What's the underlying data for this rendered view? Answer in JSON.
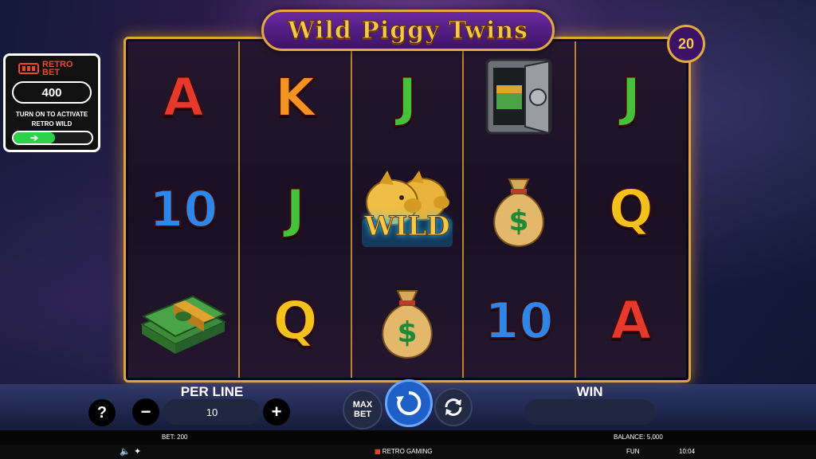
{
  "game": {
    "title": "Wild Piggy Twins",
    "lines": "20"
  },
  "retro_bet": {
    "logo_top": "RETRO",
    "logo_bottom": "BET",
    "value": "400",
    "text_line1": "TURN ON TO ACTIVATE",
    "text_line2": "RETRO WILD"
  },
  "reels": [
    [
      "A",
      "10",
      "cash-stack"
    ],
    [
      "K",
      "J",
      "Q"
    ],
    [
      "J",
      "wild-piggy",
      "money-bag"
    ],
    [
      "safe",
      "money-bag",
      "10"
    ],
    [
      "J",
      "Q",
      "A"
    ]
  ],
  "wild_label": "WILD",
  "controls": {
    "help": "?",
    "per_line_label": "PER LINE",
    "per_line_value": "10",
    "minus": "−",
    "plus": "+",
    "max_bet_line1": "MAX",
    "max_bet_line2": "BET",
    "win_label": "WIN",
    "win_value": ""
  },
  "status": {
    "bet": "BET: 200",
    "balance": "BALANCE: 5,000"
  },
  "footer": {
    "brand": "RETRO GAMING",
    "mode": "FUN",
    "time": "10:04"
  },
  "colors": {
    "gold": "#e0aa3e",
    "accent_blue": "#2b6fd6",
    "toggle_green": "#2ed24a"
  }
}
